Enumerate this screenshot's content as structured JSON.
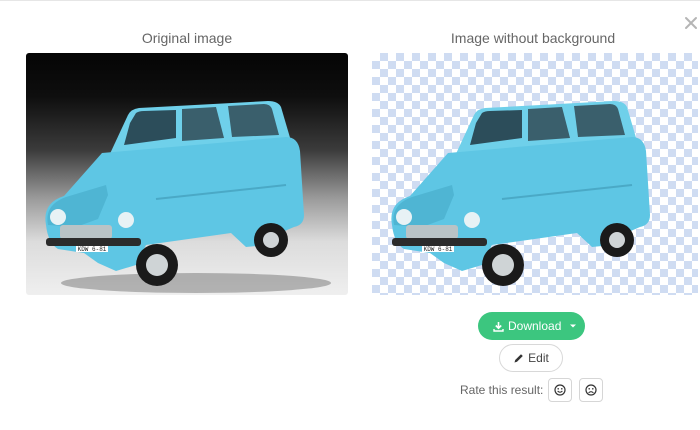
{
  "panels": {
    "original_caption": "Original image",
    "result_caption": "Image without background"
  },
  "car": {
    "plate_text": "KDW 6-81",
    "body_color": "#5ec6e4"
  },
  "actions": {
    "download_label": "Download",
    "edit_label": "Edit"
  },
  "rating": {
    "label": "Rate this result:"
  },
  "colors": {
    "accent": "#3cc67f",
    "checker": "#cfdcf2"
  },
  "icons": [
    "close-icon",
    "download-icon",
    "caret-down-icon",
    "pencil-icon",
    "smile-icon",
    "frown-icon"
  ]
}
